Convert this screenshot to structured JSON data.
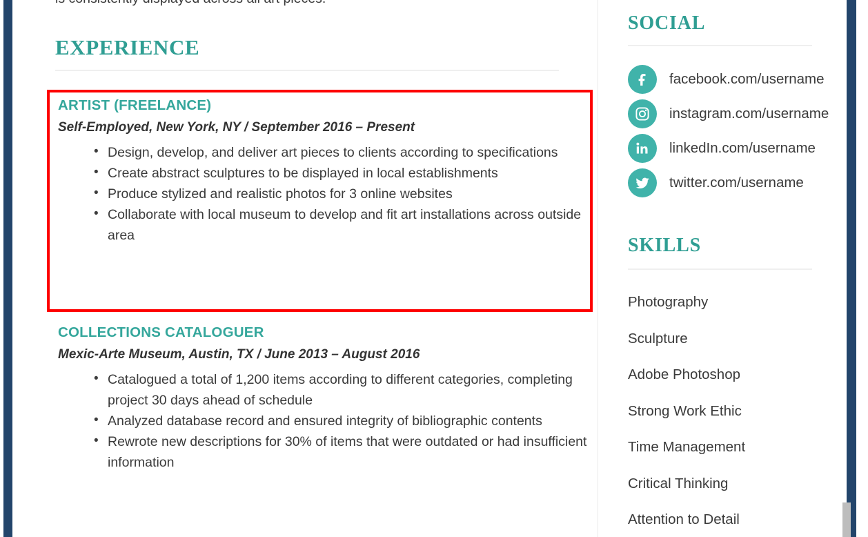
{
  "document": {
    "clipped_top_line": "is consistently displayed across all art pieces.",
    "theme_color": "#2f9e93",
    "badge_color": "#40b3aa",
    "highlight_color": "#fe0000",
    "edge_bar_color": "#23456b"
  },
  "experience": {
    "section_label": "EXPERIENCE",
    "jobs": [
      {
        "role": "ARTIST (FREELANCE)",
        "meta": "Self-Employed, New York, NY  /  September 2016 – Present",
        "bullets": [
          "Design, develop, and deliver art pieces to clients according to specifications",
          "Create abstract sculptures to be displayed in local establishments",
          "Produce stylized and realistic photos for 3 online websites",
          "Collaborate with local museum to develop and fit art installations across outside area"
        ]
      },
      {
        "role": "COLLECTIONS CATALOGUER",
        "meta": "Mexic-Arte Museum, Austin, TX  /  June 2013 – August 2016",
        "bullets": [
          "Catalogued a total of 1,200 items according to different categories, completing project 30 days ahead of schedule",
          "Analyzed database record and ensured integrity of bibliographic contents",
          "Rewrote new descriptions for 30% of items that were outdated or had insufficient information"
        ]
      }
    ]
  },
  "social": {
    "section_label": "SOCIAL",
    "items": [
      {
        "icon": "facebook-icon",
        "label": "facebook.com/username"
      },
      {
        "icon": "instagram-icon",
        "label": "instagram.com/username"
      },
      {
        "icon": "linkedin-icon",
        "label": "linkedIn.com/username"
      },
      {
        "icon": "twitter-icon",
        "label": "twitter.com/username"
      }
    ]
  },
  "skills": {
    "section_label": "SKILLS",
    "items": [
      "Photography",
      "Sculpture",
      "Adobe Photoshop",
      "Strong Work Ethic",
      "Time Management",
      "Critical Thinking",
      "Attention to Detail"
    ]
  }
}
